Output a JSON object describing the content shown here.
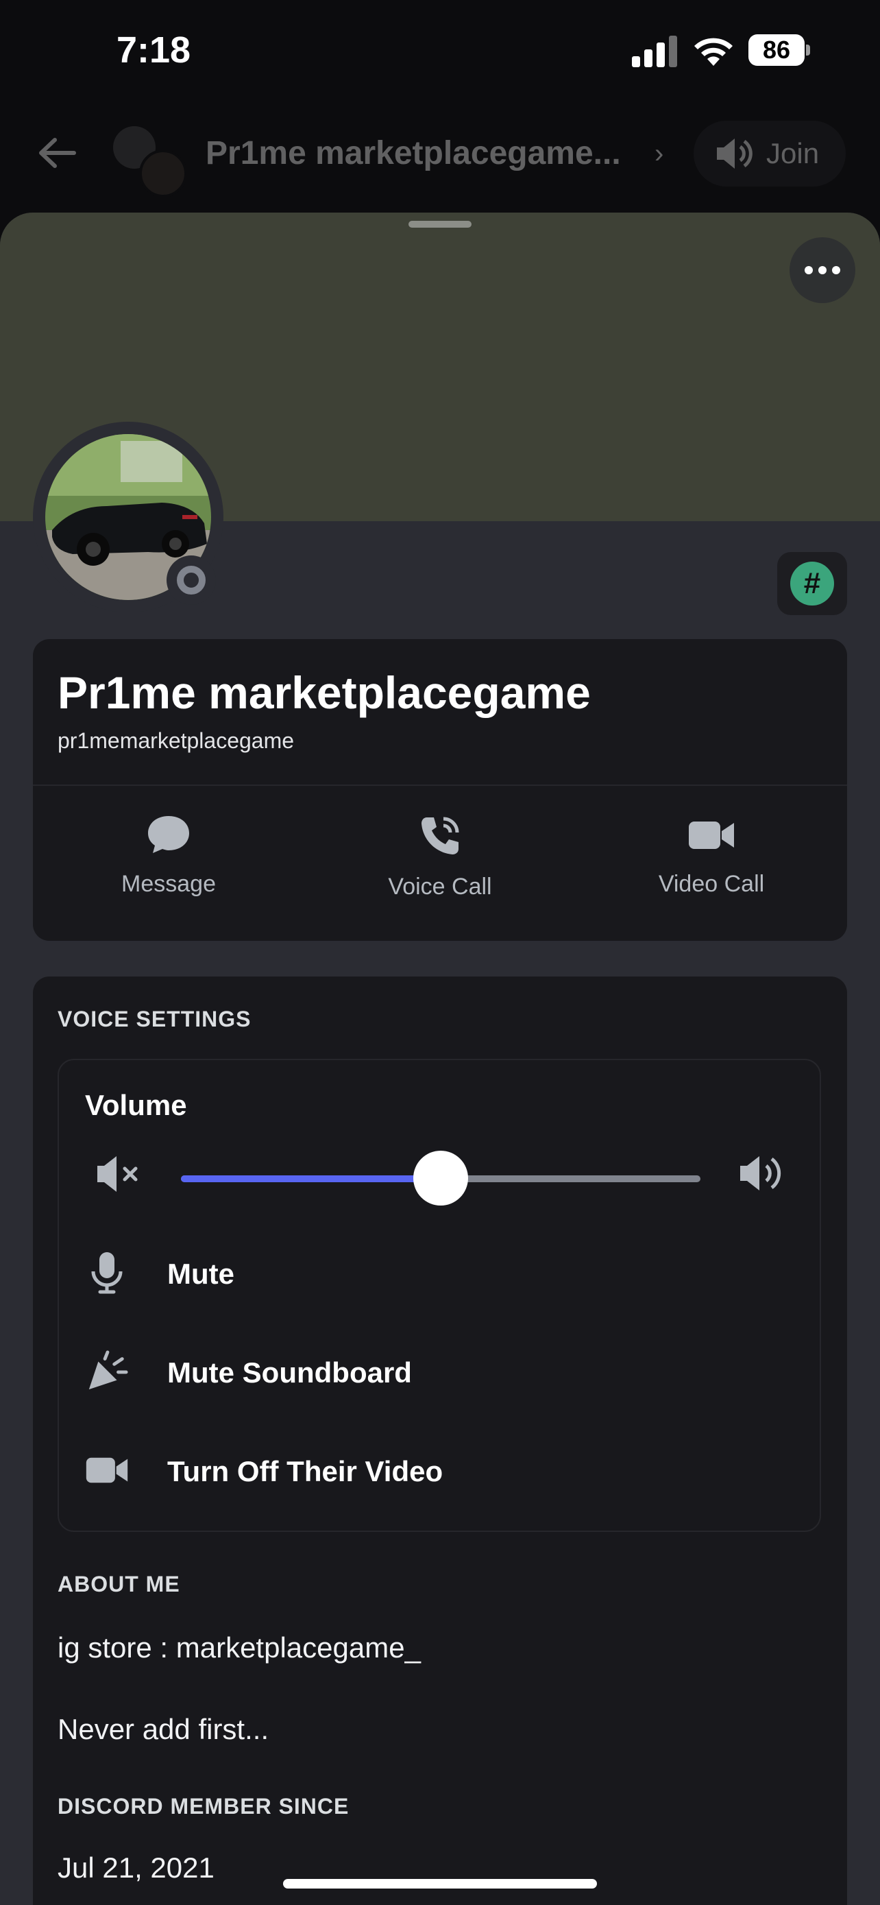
{
  "status_bar": {
    "time": "7:18",
    "battery": "86"
  },
  "header": {
    "title": "Pr1me marketplacegame...",
    "join_label": "Join"
  },
  "profile": {
    "display_name": "Pr1me marketplacegame",
    "username": "pr1memarketplacegame",
    "status": "offline",
    "badge_symbol": "#"
  },
  "actions": [
    {
      "label": "Message",
      "icon": "message-bubble-icon"
    },
    {
      "label": "Voice Call",
      "icon": "phone-call-icon"
    },
    {
      "label": "Video Call",
      "icon": "video-camera-icon"
    }
  ],
  "voice_settings": {
    "title": "VOICE SETTINGS",
    "volume_label": "Volume",
    "volume_level": 0.5,
    "options": [
      {
        "label": "Mute",
        "icon": "microphone-icon"
      },
      {
        "label": "Mute Soundboard",
        "icon": "soundboard-icon"
      },
      {
        "label": "Turn Off Their Video",
        "icon": "video-camera-icon"
      }
    ]
  },
  "about_me": {
    "title": "ABOUT ME",
    "lines": [
      "ig store : marketplacegame_",
      "Never add first..."
    ]
  },
  "member_since": {
    "title": "DISCORD MEMBER SINCE",
    "date": "Jul 21, 2021"
  },
  "colors": {
    "accent": "#5865f2",
    "banner": "#3e4136",
    "badge": "#3ba57c",
    "card": "#18181c",
    "sheet": "#2b2c33"
  }
}
